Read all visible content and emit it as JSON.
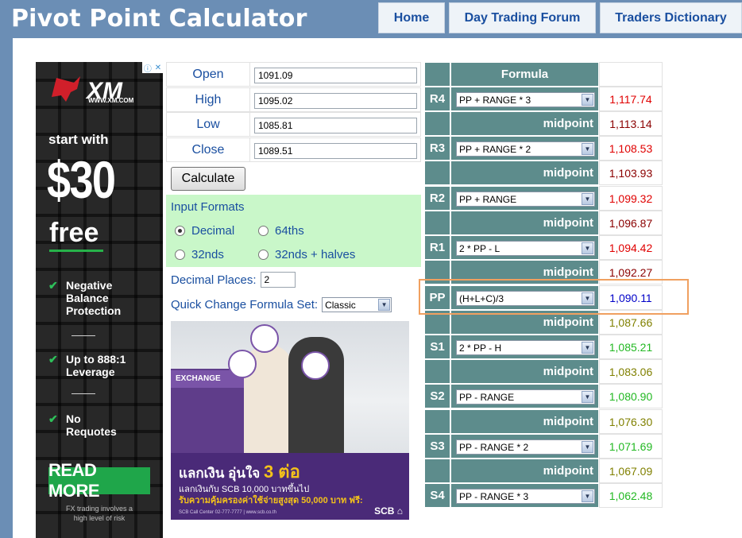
{
  "header": {
    "title": "Pivot Point Calculator",
    "nav": [
      {
        "label": "Home"
      },
      {
        "label": "Day Trading Forum"
      },
      {
        "label": "Traders Dictionary"
      }
    ]
  },
  "ad_left": {
    "brand": "XM",
    "url": "WWW.XM.COM",
    "start_with": "start with",
    "amount": "$30",
    "free": "free",
    "features": [
      "Negative Balance Protection",
      "Up to 888:1 Leverage",
      "No Requotes"
    ],
    "cta": "READ MORE",
    "disclaimer": "FX trading involves a high level of risk"
  },
  "form": {
    "fields": [
      {
        "label": "Open",
        "value": "1091.09"
      },
      {
        "label": "High",
        "value": "1095.02"
      },
      {
        "label": "Low",
        "value": "1085.81"
      },
      {
        "label": "Close",
        "value": "1089.51"
      }
    ],
    "calculate_label": "Calculate",
    "input_formats_title": "Input Formats",
    "formats": [
      {
        "label": "Decimal",
        "selected": true
      },
      {
        "label": "64ths",
        "selected": false
      },
      {
        "label": "32nds",
        "selected": false
      },
      {
        "label": "32nds + halves",
        "selected": false
      }
    ],
    "decimal_places_label": "Decimal Places:",
    "decimal_places_value": "2",
    "quick_change_label": "Quick Change Formula Set:",
    "quick_change_value": "Classic"
  },
  "ad_bank": {
    "booth_label": "EXCHANGE",
    "headline": "แลกเงิน อุ่นใจ",
    "headline_big": "3 ต่อ",
    "line2": "แลกเงินกับ SCB 10,000 บาทขึ้นไป",
    "line3": "รับความคุ้มครองค่าใช้จ่ายสูงสุด 50,000 บาท ฟรี:",
    "line4": "SCB Call Center 02-777-7777 | www.scb.co.th",
    "logo": "SCB"
  },
  "table": {
    "header": "Formula",
    "midpoint_label": "midpoint",
    "rows": [
      {
        "label": "R4",
        "formula": "PP + RANGE * 3",
        "value": "1,117.74",
        "color": "#e00000",
        "mid": "1,113.14",
        "mid_color": "#8b0000"
      },
      {
        "label": "R3",
        "formula": "PP + RANGE * 2",
        "value": "1,108.53",
        "color": "#e00000",
        "mid": "1,103.93",
        "mid_color": "#8b0000"
      },
      {
        "label": "R2",
        "formula": "PP + RANGE",
        "value": "1,099.32",
        "color": "#e00000",
        "mid": "1,096.87",
        "mid_color": "#8b0000"
      },
      {
        "label": "R1",
        "formula": "2 * PP - L",
        "value": "1,094.42",
        "color": "#e00000",
        "mid": "1,092.27",
        "mid_color": "#8b0000"
      },
      {
        "label": "PP",
        "formula": "(H+L+C)/3",
        "value": "1,090.11",
        "color": "#0000c8",
        "mid": "1,087.66",
        "mid_color": "#808000"
      },
      {
        "label": "S1",
        "formula": "2 * PP - H",
        "value": "1,085.21",
        "color": "#22b822",
        "mid": "1,083.06",
        "mid_color": "#808000"
      },
      {
        "label": "S2",
        "formula": "PP - RANGE",
        "value": "1,080.90",
        "color": "#22b822",
        "mid": "1,076.30",
        "mid_color": "#808000"
      },
      {
        "label": "S3",
        "formula": "PP - RANGE * 2",
        "value": "1,071.69",
        "color": "#22b822",
        "mid": "1,067.09",
        "mid_color": "#808000"
      },
      {
        "label": "S4",
        "formula": "PP - RANGE * 3",
        "value": "1,062.48",
        "color": "#22b822"
      }
    ]
  }
}
